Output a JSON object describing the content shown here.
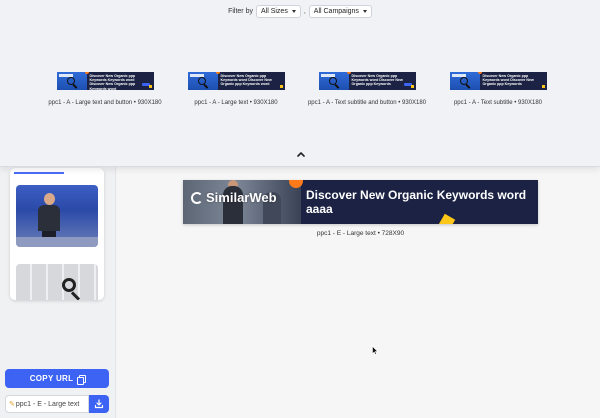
{
  "filter": {
    "label": "Filter by",
    "size_value": "All Sizes",
    "separator": ",",
    "campaign_value": "All Campaigns"
  },
  "variants": [
    {
      "banner_text": "Discover New Organic ppp Keywords Keywords word Discover New Organic ppp Keywords word",
      "caption": "ppc1 - A - Large text and button • 930X180"
    },
    {
      "banner_text": "Discover New Organic ppp Keywords word Discover New Organic ppp Keywords word",
      "caption": "ppc1 - A - Large text • 930X180"
    },
    {
      "banner_text": "Discover New Organic ppp Keywords word Discover New Organic ppp Keywords",
      "caption": "ppc1 - A - Text subtitle and button • 930X180"
    },
    {
      "banner_text": "Discover New Organic ppp Keywords word Discover New Organic ppp Keywords",
      "caption": "ppc1 - A - Text subtitle • 930X180"
    }
  ],
  "preview": {
    "logo_text": "SimilarWeb",
    "headline": "Discover New Organic Keywords word aaaa",
    "caption": "ppc1 - E - Large text • 728X90"
  },
  "sidebar": {
    "copy_url_label": "COPY URL",
    "filename_value": "ppc1 - E - Large text"
  },
  "colors": {
    "accent": "#3d63f4",
    "banner_bg": "#1b2243",
    "brand_orange": "#ff7a1a",
    "brand_yellow": "#ffc61a"
  }
}
